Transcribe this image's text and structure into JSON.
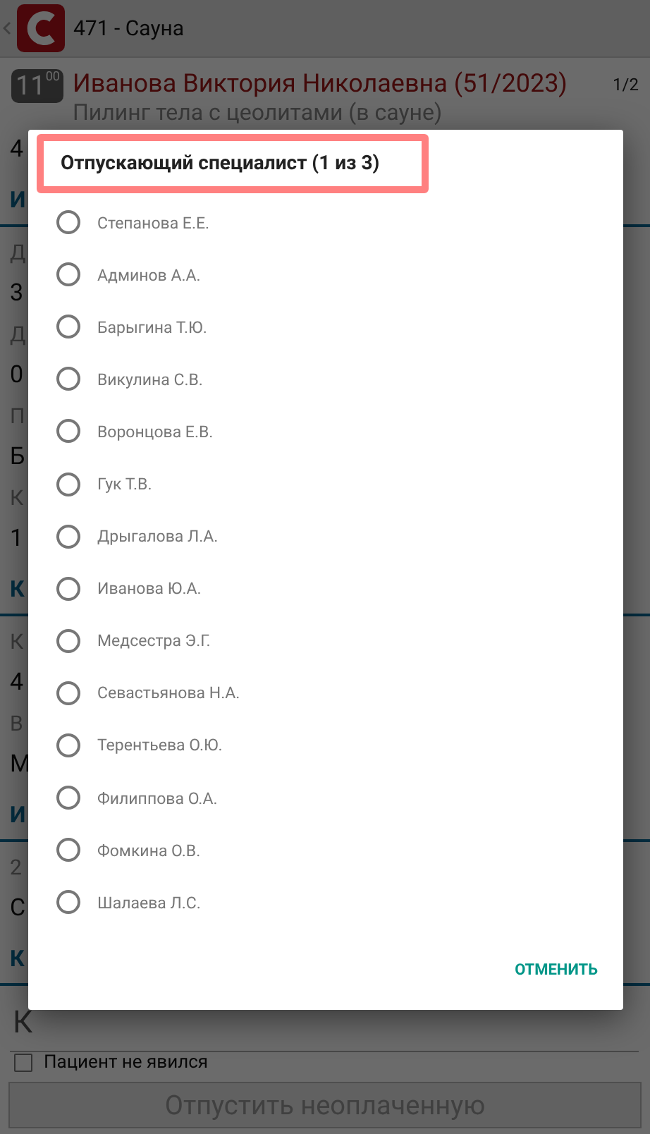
{
  "app_bar": {
    "title": "471 - Сауна"
  },
  "appointment": {
    "time_hour": "11",
    "time_minutes": "00",
    "patient": "Иванова Виктория Николаевна (51/2023)",
    "counter": "1/2",
    "service": "Пилинг тела с цеолитами (в сауне)"
  },
  "background_rows": [
    {
      "kind": "value",
      "text": "4"
    },
    {
      "kind": "section",
      "text": "И"
    },
    {
      "kind": "label",
      "text": "Д"
    },
    {
      "kind": "value",
      "text": "3"
    },
    {
      "kind": "label",
      "text": "Д"
    },
    {
      "kind": "value",
      "text": "0"
    },
    {
      "kind": "label",
      "text": "П"
    },
    {
      "kind": "value",
      "text": "Б"
    },
    {
      "kind": "label",
      "text": "К"
    },
    {
      "kind": "value",
      "text": "1"
    },
    {
      "kind": "section",
      "text": "К"
    },
    {
      "kind": "label",
      "text": "К"
    },
    {
      "kind": "value",
      "text": "4"
    },
    {
      "kind": "label",
      "text": "В"
    },
    {
      "kind": "value",
      "text": "М"
    },
    {
      "kind": "section",
      "text": "И"
    },
    {
      "kind": "label",
      "text": "2"
    },
    {
      "kind": "value",
      "text": "С"
    },
    {
      "kind": "section",
      "text": "К"
    },
    {
      "kind": "input",
      "text": "К"
    }
  ],
  "no_show": {
    "label": "Пациент не явился",
    "checked": false
  },
  "release_button": {
    "label": "Отпустить неоплаченную",
    "disabled": true
  },
  "dialog": {
    "title": "Отпускающий специалист (1 из 3)",
    "title_highlighted": true,
    "options": [
      {
        "label": "Степанова Е.Е.",
        "selected": false
      },
      {
        "label": "Админов А.А.",
        "selected": false
      },
      {
        "label": "Барыгина Т.Ю.",
        "selected": false
      },
      {
        "label": "Викулина С.В.",
        "selected": false
      },
      {
        "label": "Воронцова Е.В.",
        "selected": false
      },
      {
        "label": "Гук Т.В.",
        "selected": false
      },
      {
        "label": "Дрыгалова Л.А.",
        "selected": false
      },
      {
        "label": "Иванова Ю.А.",
        "selected": false
      },
      {
        "label": "Медсестра Э.Г.",
        "selected": false
      },
      {
        "label": "Севастьянова Н.А.",
        "selected": false
      },
      {
        "label": "Терентьева О.Ю.",
        "selected": false
      },
      {
        "label": "Филиппова О.А.",
        "selected": false
      },
      {
        "label": "Фомкина О.В.",
        "selected": false
      },
      {
        "label": "Шалаева Л.С.",
        "selected": false
      }
    ],
    "cancel": "ОТМЕНИТЬ"
  }
}
